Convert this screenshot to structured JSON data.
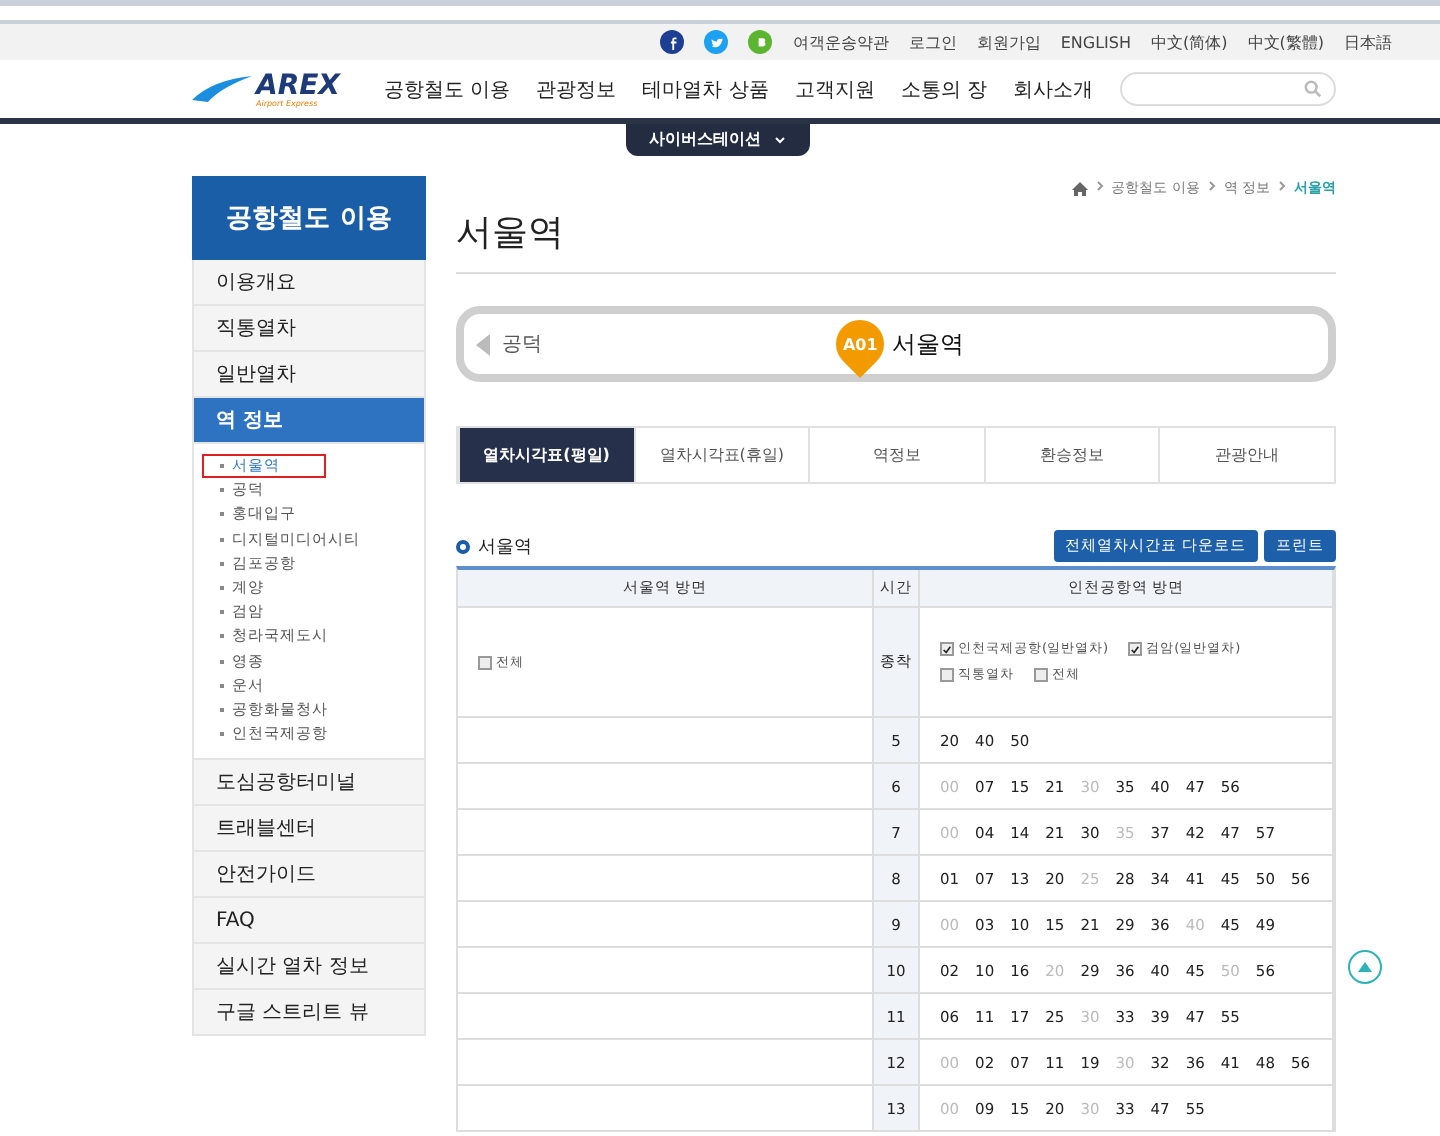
{
  "top_bar": {
    "social": [
      {
        "kind": "facebook",
        "color": "#1c3f94"
      },
      {
        "kind": "twitter",
        "color": "#1da1f2"
      },
      {
        "kind": "blog",
        "color": "#5cb531"
      }
    ],
    "links": [
      "여객운송약관",
      "로그인",
      "회원가입",
      "ENGLISH",
      "中文(简体)",
      "中文(繁體)",
      "日本語"
    ]
  },
  "header": {
    "logo": "AREX",
    "logo_sub": "Airport Express",
    "nav": [
      "공항철도 이용",
      "관광정보",
      "테마열차 상품",
      "고객지원",
      "소통의 장",
      "회사소개"
    ],
    "dropdown_tab": "사이버스테이션"
  },
  "sidebar": {
    "title": "공항철도 이용",
    "items": [
      {
        "label": "이용개요",
        "selected": false
      },
      {
        "label": "직통열차",
        "selected": false
      },
      {
        "label": "일반열차",
        "selected": false
      },
      {
        "label": "역 정보",
        "selected": true,
        "children": [
          {
            "label": "서울역",
            "selected": true
          },
          {
            "label": "공덕",
            "selected": false
          },
          {
            "label": "홍대입구",
            "selected": false
          },
          {
            "label": "디지털미디어시티",
            "selected": false
          },
          {
            "label": "김포공항",
            "selected": false
          },
          {
            "label": "계양",
            "selected": false
          },
          {
            "label": "검암",
            "selected": false
          },
          {
            "label": "청라국제도시",
            "selected": false
          },
          {
            "label": "영종",
            "selected": false
          },
          {
            "label": "운서",
            "selected": false
          },
          {
            "label": "공항화물청사",
            "selected": false
          },
          {
            "label": "인천국제공항",
            "selected": false
          }
        ]
      },
      {
        "label": "도심공항터미널",
        "selected": false
      },
      {
        "label": "트래블센터",
        "selected": false
      },
      {
        "label": "안전가이드",
        "selected": false
      },
      {
        "label": "FAQ",
        "selected": false
      },
      {
        "label": "실시간 열차 정보",
        "selected": false
      },
      {
        "label": "구글 스트리트 뷰",
        "selected": false
      }
    ]
  },
  "breadcrumb": [
    "공항철도 이용",
    "역 정보",
    "서울역"
  ],
  "page_title": "서울역",
  "station_bar": {
    "prev": "공덕",
    "code": "A01",
    "name": "서울역"
  },
  "tabs": [
    {
      "label": "열차시각표(평일)",
      "selected": true
    },
    {
      "label": "열차시각표(휴일)",
      "selected": false
    },
    {
      "label": "역정보",
      "selected": false
    },
    {
      "label": "환승정보",
      "selected": false
    },
    {
      "label": "관광안내",
      "selected": false
    }
  ],
  "timetable": {
    "station": "서울역",
    "buttons": [
      "전체열차시간표 다운로드",
      "프린트"
    ],
    "columns": [
      "서울역 방면",
      "시간",
      "인천공항역 방면"
    ],
    "left_filters": [
      {
        "label": "전체",
        "checked": false
      }
    ],
    "end_label": "종착",
    "right_filters": [
      {
        "label": "인천국제공항(일반열차)",
        "checked": true
      },
      {
        "label": "검암(일반열차)",
        "checked": true
      },
      {
        "label": "직통열차",
        "checked": false
      },
      {
        "label": "전체",
        "checked": false
      }
    ],
    "rows": [
      {
        "hour": "5",
        "minutes": [
          {
            "t": "20",
            "dimmed": false
          },
          {
            "t": "40",
            "dimmed": false
          },
          {
            "t": "50",
            "dimmed": false
          }
        ]
      },
      {
        "hour": "6",
        "minutes": [
          {
            "t": "00",
            "dimmed": true
          },
          {
            "t": "07",
            "dimmed": false
          },
          {
            "t": "15",
            "dimmed": false
          },
          {
            "t": "21",
            "dimmed": false
          },
          {
            "t": "30",
            "dimmed": true
          },
          {
            "t": "35",
            "dimmed": false
          },
          {
            "t": "40",
            "dimmed": false
          },
          {
            "t": "47",
            "dimmed": false
          },
          {
            "t": "56",
            "dimmed": false
          }
        ]
      },
      {
        "hour": "7",
        "minutes": [
          {
            "t": "00",
            "dimmed": true
          },
          {
            "t": "04",
            "dimmed": false
          },
          {
            "t": "14",
            "dimmed": false
          },
          {
            "t": "21",
            "dimmed": false
          },
          {
            "t": "30",
            "dimmed": false
          },
          {
            "t": "35",
            "dimmed": true
          },
          {
            "t": "37",
            "dimmed": false
          },
          {
            "t": "42",
            "dimmed": false
          },
          {
            "t": "47",
            "dimmed": false
          },
          {
            "t": "57",
            "dimmed": false
          }
        ]
      },
      {
        "hour": "8",
        "minutes": [
          {
            "t": "01",
            "dimmed": false
          },
          {
            "t": "07",
            "dimmed": false
          },
          {
            "t": "13",
            "dimmed": false
          },
          {
            "t": "20",
            "dimmed": false
          },
          {
            "t": "25",
            "dimmed": true
          },
          {
            "t": "28",
            "dimmed": false
          },
          {
            "t": "34",
            "dimmed": false
          },
          {
            "t": "41",
            "dimmed": false
          },
          {
            "t": "45",
            "dimmed": false
          },
          {
            "t": "50",
            "dimmed": false
          },
          {
            "t": "56",
            "dimmed": false
          }
        ]
      },
      {
        "hour": "9",
        "minutes": [
          {
            "t": "00",
            "dimmed": true
          },
          {
            "t": "03",
            "dimmed": false
          },
          {
            "t": "10",
            "dimmed": false
          },
          {
            "t": "15",
            "dimmed": false
          },
          {
            "t": "21",
            "dimmed": false
          },
          {
            "t": "29",
            "dimmed": false
          },
          {
            "t": "36",
            "dimmed": false
          },
          {
            "t": "40",
            "dimmed": true
          },
          {
            "t": "45",
            "dimmed": false
          },
          {
            "t": "49",
            "dimmed": false
          }
        ]
      },
      {
        "hour": "10",
        "minutes": [
          {
            "t": "02",
            "dimmed": false
          },
          {
            "t": "10",
            "dimmed": false
          },
          {
            "t": "16",
            "dimmed": false
          },
          {
            "t": "20",
            "dimmed": true
          },
          {
            "t": "29",
            "dimmed": false
          },
          {
            "t": "36",
            "dimmed": false
          },
          {
            "t": "40",
            "dimmed": false
          },
          {
            "t": "45",
            "dimmed": false
          },
          {
            "t": "50",
            "dimmed": true
          },
          {
            "t": "56",
            "dimmed": false
          }
        ]
      },
      {
        "hour": "11",
        "minutes": [
          {
            "t": "06",
            "dimmed": false
          },
          {
            "t": "11",
            "dimmed": false
          },
          {
            "t": "17",
            "dimmed": false
          },
          {
            "t": "25",
            "dimmed": false
          },
          {
            "t": "30",
            "dimmed": true
          },
          {
            "t": "33",
            "dimmed": false
          },
          {
            "t": "39",
            "dimmed": false
          },
          {
            "t": "47",
            "dimmed": false
          },
          {
            "t": "55",
            "dimmed": false
          }
        ]
      },
      {
        "hour": "12",
        "minutes": [
          {
            "t": "00",
            "dimmed": true
          },
          {
            "t": "02",
            "dimmed": false
          },
          {
            "t": "07",
            "dimmed": false
          },
          {
            "t": "11",
            "dimmed": false
          },
          {
            "t": "19",
            "dimmed": false
          },
          {
            "t": "30",
            "dimmed": true
          },
          {
            "t": "32",
            "dimmed": false
          },
          {
            "t": "36",
            "dimmed": false
          },
          {
            "t": "41",
            "dimmed": false
          },
          {
            "t": "48",
            "dimmed": false
          },
          {
            "t": "56",
            "dimmed": false
          }
        ]
      },
      {
        "hour": "13",
        "minutes": [
          {
            "t": "00",
            "dimmed": true
          },
          {
            "t": "09",
            "dimmed": false
          },
          {
            "t": "15",
            "dimmed": false
          },
          {
            "t": "20",
            "dimmed": false
          },
          {
            "t": "30",
            "dimmed": true
          },
          {
            "t": "33",
            "dimmed": false
          },
          {
            "t": "47",
            "dimmed": false
          },
          {
            "t": "55",
            "dimmed": false
          }
        ]
      }
    ]
  }
}
